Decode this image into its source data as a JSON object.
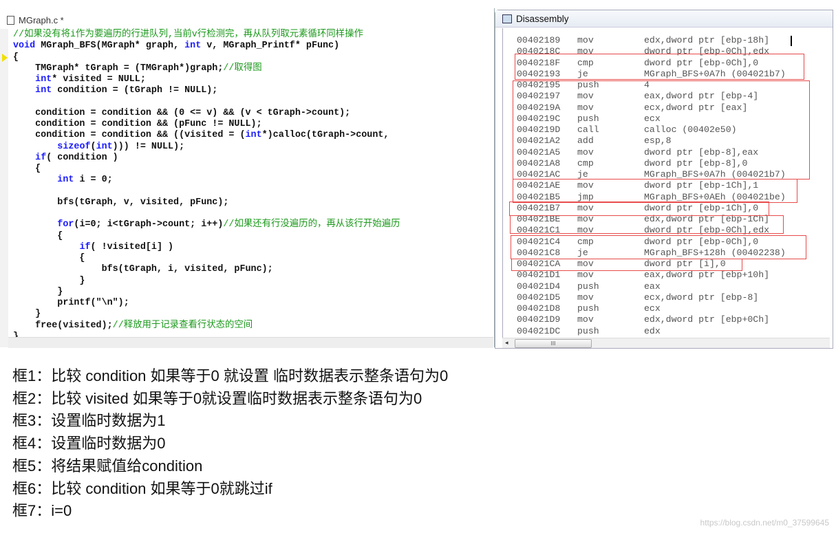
{
  "editor": {
    "tab_title": "MGraph.c *",
    "lines": [
      [
        [
          "//如果没有将i作为要遍历的行进队列,当前v行检测完，再从队列取元素循环同样操作",
          "c"
        ]
      ],
      [
        [
          "void",
          "k"
        ],
        [
          " MGraph_BFS(MGraph* graph, ",
          ""
        ],
        [
          "int",
          "k"
        ],
        [
          " v, MGraph_Printf* pFunc)",
          ""
        ]
      ],
      [
        [
          "{",
          ""
        ]
      ],
      [
        [
          "    TMGraph* tGraph = (TMGraph*)graph;",
          ""
        ],
        [
          "//取得图",
          "c"
        ]
      ],
      [
        [
          "    ",
          ""
        ],
        [
          "int",
          "k"
        ],
        [
          "* visited = NULL;",
          ""
        ]
      ],
      [
        [
          "    ",
          ""
        ],
        [
          "int",
          "k"
        ],
        [
          " condition = (tGraph != NULL);",
          ""
        ]
      ],
      [
        [
          "",
          ""
        ]
      ],
      [
        [
          "    condition = condition && (0 <= v) && (v < tGraph->count);",
          ""
        ]
      ],
      [
        [
          "    condition = condition && (pFunc != NULL);",
          ""
        ]
      ],
      [
        [
          "    condition = condition && ((visited = (",
          ""
        ],
        [
          "int",
          "k"
        ],
        [
          "*)calloc(tGraph->count,",
          ""
        ]
      ],
      [
        [
          "        ",
          ""
        ],
        [
          "sizeof",
          "k"
        ],
        [
          "(",
          ""
        ],
        [
          "int",
          "k"
        ],
        [
          "))) != NULL);",
          ""
        ]
      ],
      [
        [
          "    ",
          ""
        ],
        [
          "if",
          "k"
        ],
        [
          "( condition )",
          ""
        ]
      ],
      [
        [
          "    {",
          ""
        ]
      ],
      [
        [
          "        ",
          ""
        ],
        [
          "int",
          "k"
        ],
        [
          " i = 0;",
          ""
        ]
      ],
      [
        [
          "",
          ""
        ]
      ],
      [
        [
          "        bfs(tGraph, v, visited, pFunc);",
          ""
        ]
      ],
      [
        [
          "",
          ""
        ]
      ],
      [
        [
          "        ",
          ""
        ],
        [
          "for",
          "k"
        ],
        [
          "(i=0; i<tGraph->count; i++)",
          ""
        ],
        [
          "//如果还有行没遍历的，再从该行开始遍历",
          "c"
        ]
      ],
      [
        [
          "        {",
          ""
        ]
      ],
      [
        [
          "            ",
          ""
        ],
        [
          "if",
          "k"
        ],
        [
          "( !visited[i] )",
          ""
        ]
      ],
      [
        [
          "            {",
          ""
        ]
      ],
      [
        [
          "                bfs(tGraph, i, visited, pFunc);",
          ""
        ]
      ],
      [
        [
          "            }",
          ""
        ]
      ],
      [
        [
          "        }",
          ""
        ]
      ],
      [
        [
          "        printf(\"\\n\");",
          ""
        ]
      ],
      [
        [
          "    }",
          ""
        ]
      ],
      [
        [
          "    free(visited);",
          ""
        ],
        [
          "//释放用于记录查看行状态的空间",
          "c"
        ]
      ],
      [
        [
          "}",
          ""
        ]
      ]
    ]
  },
  "disassembly": {
    "title": "Disassembly",
    "rows": [
      {
        "addr": "00402189",
        "op": "mov",
        "args": "edx,dword ptr [ebp-18h]"
      },
      {
        "addr": "0040218C",
        "op": "mov",
        "args": "dword ptr [ebp-0Ch],edx"
      },
      {
        "addr": "0040218F",
        "op": "cmp",
        "args": "dword ptr [ebp-0Ch],0"
      },
      {
        "addr": "00402193",
        "op": "je",
        "args": "MGraph_BFS+0A7h (004021b7)"
      },
      {
        "addr": "00402195",
        "op": "push",
        "args": "4"
      },
      {
        "addr": "00402197",
        "op": "mov",
        "args": "eax,dword ptr [ebp-4]"
      },
      {
        "addr": "0040219A",
        "op": "mov",
        "args": "ecx,dword ptr [eax]"
      },
      {
        "addr": "0040219C",
        "op": "push",
        "args": "ecx"
      },
      {
        "addr": "0040219D",
        "op": "call",
        "args": "calloc (00402e50)"
      },
      {
        "addr": "004021A2",
        "op": "add",
        "args": "esp,8"
      },
      {
        "addr": "004021A5",
        "op": "mov",
        "args": "dword ptr [ebp-8],eax"
      },
      {
        "addr": "004021A8",
        "op": "cmp",
        "args": "dword ptr [ebp-8],0"
      },
      {
        "addr": "004021AC",
        "op": "je",
        "args": "MGraph_BFS+0A7h (004021b7)"
      },
      {
        "addr": "004021AE",
        "op": "mov",
        "args": "dword ptr [ebp-1Ch],1"
      },
      {
        "addr": "004021B5",
        "op": "jmp",
        "args": "MGraph_BFS+0AEh (004021be)"
      },
      {
        "addr": "004021B7",
        "op": "mov",
        "args": "dword ptr [ebp-1Ch],0"
      },
      {
        "addr": "004021BE",
        "op": "mov",
        "args": "edx,dword ptr [ebp-1Ch]"
      },
      {
        "addr": "004021C1",
        "op": "mov",
        "args": "dword ptr [ebp-0Ch],edx"
      },
      {
        "addr": "004021C4",
        "op": "cmp",
        "args": "dword ptr [ebp-0Ch],0"
      },
      {
        "addr": "004021C8",
        "op": "je",
        "args": "MGraph_BFS+128h (00402238)"
      },
      {
        "addr": "004021CA",
        "op": "mov",
        "args": "dword ptr [i],0"
      },
      {
        "addr": "004021D1",
        "op": "mov",
        "args": "eax,dword ptr [ebp+10h]"
      },
      {
        "addr": "004021D4",
        "op": "push",
        "args": "eax"
      },
      {
        "addr": "004021D5",
        "op": "mov",
        "args": "ecx,dword ptr [ebp-8]"
      },
      {
        "addr": "004021D8",
        "op": "push",
        "args": "ecx"
      },
      {
        "addr": "004021D9",
        "op": "mov",
        "args": "edx,dword ptr [ebp+0Ch]"
      },
      {
        "addr": "004021DC",
        "op": "push",
        "args": "edx"
      }
    ],
    "scroll_thumb": "III",
    "highlight_color": "#e84a4a"
  },
  "notes": [
    "框1：比较 condition 如果等于0 就设置 临时数据表示整条语句为0",
    "框2：比较 visited 如果等于0就设置临时数据表示整条语句为0",
    "框3：设置临时数据为1",
    "框4：设置临时数据为0",
    "框5：将结果赋值给condition",
    "框6：比较 condition 如果等于0就跳过if",
    "框7：i=0"
  ],
  "watermark": "https://blog.csdn.net/m0_37599645"
}
